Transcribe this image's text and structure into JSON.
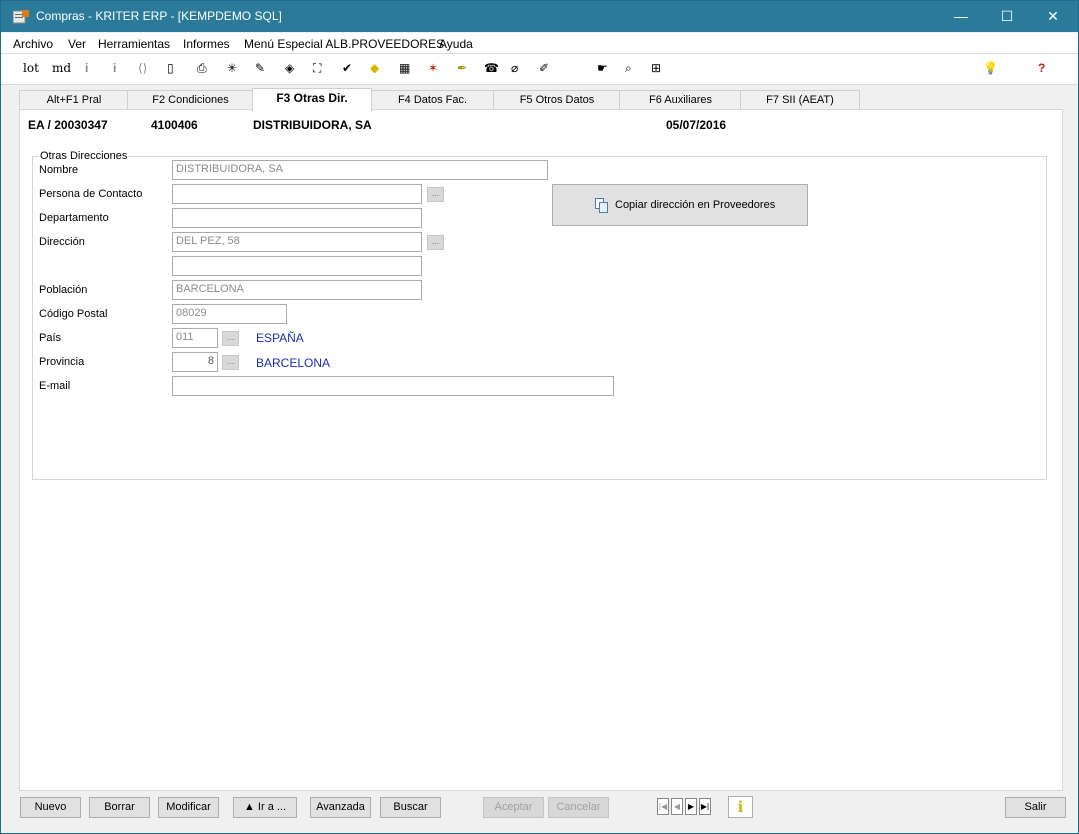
{
  "window": {
    "title": "Compras - KRITER ERP - [KEMPDEMO SQL]",
    "minimize": "—",
    "maximize": "☐",
    "close": "✕"
  },
  "menu": [
    "Archivo",
    "Ver",
    "Herramientas",
    "Informes",
    "Menú Especial ALB.PROVEEDORES",
    "Ayuda"
  ],
  "toolbar": {
    "lot": "lot",
    "md": "md",
    "icons": [
      "info-icon",
      "info-icon",
      "bracket-nav-icon",
      "print-preview-icon",
      "printer-icon",
      "sparkle-icon",
      "tools-icon",
      "tag-icon",
      "network-icon",
      "check-icon",
      "warning-icon",
      "calculator-icon",
      "palette-icon",
      "marker-icon",
      "phone-icon",
      "paperclip-icon",
      "clip-icon",
      "hand-icon",
      "search-doc-icon",
      "grid-icon",
      "lightbulb-icon",
      "help-icon"
    ]
  },
  "tabs": [
    "Alt+F1 Pral",
    "F2 Condiciones",
    "F3 Otras Dir.",
    "F4 Datos Fac.",
    "F5 Otros Datos",
    "F6 Auxiliares",
    "F7 SII (AEAT)"
  ],
  "header": {
    "doc": "EA / 20030347",
    "code": "4100406",
    "name": "DISTRIBUIDORA, SA",
    "date": "05/07/2016"
  },
  "form": {
    "group_title": "Otras Direcciones",
    "labels": {
      "nombre": "Nombre",
      "contacto": "Persona de Contacto",
      "departamento": "Departamento",
      "direccion": "Dirección",
      "poblacion": "Población",
      "cp": "Código Postal",
      "pais": "País",
      "provincia": "Provincia",
      "email": "E-mail"
    },
    "values": {
      "nombre": "DISTRIBUIDORA, SA",
      "contacto": "",
      "departamento": "",
      "direccion1": "DEL PEZ, 58",
      "direccion2": "",
      "poblacion": "BARCELONA",
      "cp": "08029",
      "pais_code": "011",
      "pais_name": "ESPAÑA",
      "provincia_code": "8",
      "provincia_name": "BARCELONA",
      "email": ""
    },
    "dots": "...",
    "copy_button": "Copiar dirección en Proveedores"
  },
  "buttons": {
    "nuevo": "Nuevo",
    "borrar": "Borrar",
    "modificar": "Modificar",
    "ira": "▲ Ir a ...",
    "avanzada": "Avanzada",
    "buscar": "Buscar",
    "aceptar": "Aceptar",
    "cancelar": "Cancelar",
    "info": "i",
    "salir": "Salir"
  },
  "nav": [
    "|◀",
    "◀",
    "▶",
    "▶|"
  ]
}
